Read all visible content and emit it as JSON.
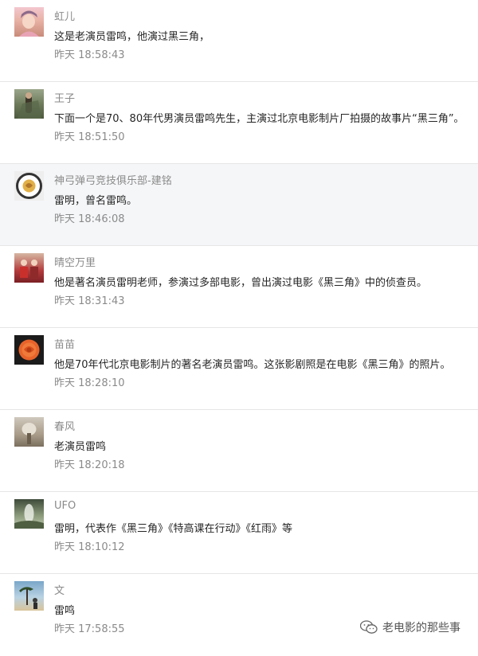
{
  "comments": [
    {
      "nickname": "虹儿",
      "text": "这是老演员雷鸣，他演过黑三角，",
      "time": "昨天 18:58:43"
    },
    {
      "nickname": "王子",
      "text": "下面一个是70、80年代男演员雷鸣先生，主演过北京电影制片厂拍摄的故事片“黑三角”。",
      "time": "昨天 18:51:50"
    },
    {
      "nickname": "神弓弹弓竞技俱乐部-建铭",
      "text": "雷明，曾名雷鸣。",
      "time": "昨天 18:46:08"
    },
    {
      "nickname": "晴空万里",
      "text": "他是著名演员雷明老师，参演过多部电影，曾出演过电影《黑三角》中的侦查员。",
      "time": "昨天 18:31:43"
    },
    {
      "nickname": "苗苗",
      "text": "他是70年代北京电影制片的著名老演员雷鸣。这张影剧照是在电影《黑三角》的照片。",
      "time": "昨天 18:28:10"
    },
    {
      "nickname": "春风",
      "text": "老演员雷鸣",
      "time": "昨天 18:20:18"
    },
    {
      "nickname": "UFO",
      "text": "雷明，代表作《黑三角》《特高课在行动》《红雨》等",
      "time": "昨天 18:10:12"
    },
    {
      "nickname": "文",
      "text": "雷鸣",
      "time": "昨天 17:58:55"
    }
  ],
  "watermark": {
    "text": "老电影的那些事",
    "icon": "wechat-icon"
  },
  "colors": {
    "nickname": "#8a8a8a",
    "text": "#262626",
    "time": "#8a8a8a",
    "divider": "#e6e6e6",
    "highlight_bg": "#f5f6f8"
  }
}
